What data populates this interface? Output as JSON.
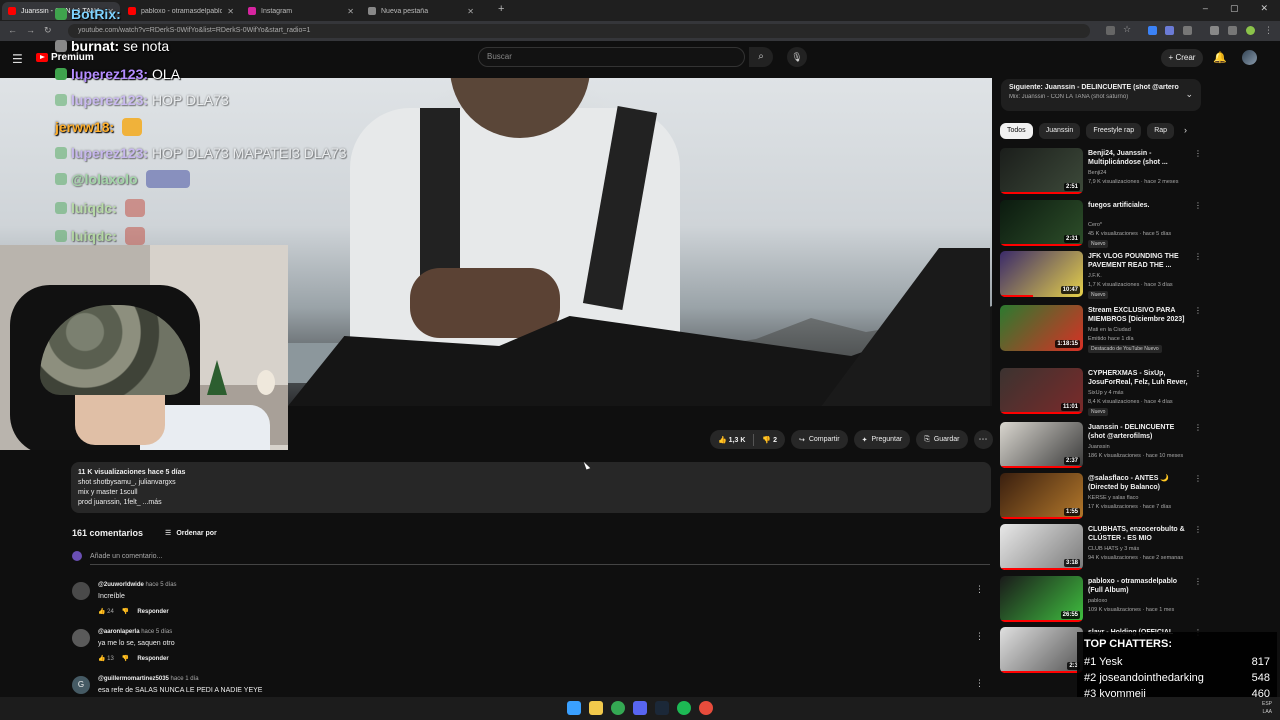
{
  "browser": {
    "tabs": [
      {
        "label": "Juanssin - CON LA TANA (s",
        "icon_color": "#ff0000",
        "active": true
      },
      {
        "label": "pabloxo - otramasdelpablo (Fu",
        "icon_color": "#ff0000",
        "active": false
      },
      {
        "label": "Instagram",
        "icon_color": "#d6249f",
        "active": false
      },
      {
        "label": "Nueva pestaña",
        "icon_color": "#888888",
        "active": false
      }
    ],
    "url": "youtube.com/watch?v=RDerkS-0WifYo&list=RDerkS-0WifYo&start_radio=1"
  },
  "youtube": {
    "logo_text": "Premium",
    "search_placeholder": "Buscar",
    "create_label": "Crear"
  },
  "video_actions": {
    "likes": "1,3 K",
    "dislikes": "2",
    "share": "Compartir",
    "ask": "Preguntar",
    "save": "Guardar"
  },
  "description": {
    "line1": "11 K visualizaciones  hace 5 días",
    "line2": "shot shotbysamu_, julianvargxs",
    "line3": "mix y master 1scull",
    "line4": "prod juanssin, 1felt_ ...más"
  },
  "comments": {
    "count_label": "161 comentarios",
    "sort_label": "Ordenar por",
    "add_placeholder": "Añade un comentario...",
    "items": [
      {
        "author": "@2uuworldwide",
        "time": "hace 5 días",
        "text": "Increíble",
        "likes": "24",
        "reply": "Responder",
        "avatar": "#4a4a4a"
      },
      {
        "author": "@aaronlaperla",
        "time": "hace 5 días",
        "text": "ya me lo se, saquen otro",
        "likes": "13",
        "reply": "Responder",
        "avatar": "#5a5a5a"
      },
      {
        "author": "@guillermomartinez5035",
        "time": "hace 1 día",
        "text": "esa refe de SALAS NUNCA LE PEDI A NADIE YEYE",
        "avatar_letter": "G",
        "avatar": "#455a64"
      }
    ]
  },
  "sidebar": {
    "up_next_title": "Siguiente: Juanssin - DELINCUENTE (shot @artero...",
    "up_next_sub": "Mix: Juanssin - CON LA TANA (shot saturno)",
    "chips": [
      "Todos",
      "Juanssin",
      "Freestyle rap",
      "Rap"
    ],
    "recommendations": [
      {
        "title": "Benji24, Juanssin - Multiplicándose (shot ...",
        "channel": "Benji24",
        "views": "7,9 K visualizaciones · hace 2 meses",
        "duration": "2:51",
        "colors": [
          "#1b1e1b",
          "#3d4a3a"
        ],
        "progress": 1
      },
      {
        "title": "fuegos artificiales.",
        "channel": "Cero*",
        "views": "45 K visualizaciones · hace 5 días",
        "tag": "Nuevo",
        "duration": "2:31",
        "colors": [
          "#0b1a0f",
          "#2e4f2a"
        ],
        "progress": 1
      },
      {
        "title": "JFK VLOG POUNDING THE PAVEMENT READ THE ...",
        "channel": "J.F.K.",
        "views": "1,7 K visualizaciones · hace 3 días",
        "tag": "Nuevo",
        "duration": "10:47",
        "colors": [
          "#3a2a6a",
          "#e6d14a"
        ],
        "progress": 0.4
      },
      {
        "title": "Stream EXCLUSIVO PARA MIEMBROS [Diciembre 2023]",
        "channel": "Mati en la Ciudad",
        "views": "Emitido hace 1 día",
        "tag": "Destacado de YouTube  Nuevo",
        "duration": "1:18:15",
        "colors": [
          "#2b7a2f",
          "#d93025"
        ],
        "progress": 0
      },
      {
        "title": "CYPHERXMAS - SixUp, JosuForReal, Felz, Luh Rever, ...",
        "channel": "SixUp y 4 más",
        "views": "8,4 K visualizaciones · hace 4 días",
        "tag": "Nuevo",
        "duration": "11:01",
        "colors": [
          "#3b3330",
          "#7b2a2a"
        ],
        "progress": 1
      },
      {
        "title": "Juanssin - DELINCUENTE (shot @arterofilms)",
        "channel": "Juanssin",
        "views": "186 K visualizaciones · hace 10 meses",
        "duration": "2:37",
        "colors": [
          "#d9d6cf",
          "#3a3a3a"
        ],
        "progress": 1
      },
      {
        "title": "@salasflaco - ANTES 🌙 (Directed by Balanco)",
        "channel": "KERSE y salas flaco",
        "views": "17 K visualizaciones · hace 7 días",
        "duration": "1:55",
        "colors": [
          "#3a1f0f",
          "#b3782b"
        ],
        "progress": 1
      },
      {
        "title": "CLUBHATS, enzocerobulto & CLÚSTER - ES MIO",
        "channel": "CLUB HATS y 3 más",
        "views": "94 K visualizaciones · hace 2 semanas",
        "duration": "3:18",
        "colors": [
          "#e8e8e8",
          "#7a7a7a"
        ],
        "progress": 1
      },
      {
        "title": "pabloxo - otramasdelpablo (Full Album)",
        "channel": "pabloxo",
        "views": "109 K visualizaciones · hace 1 mes",
        "duration": "26:55",
        "colors": [
          "#1a1a1a",
          "#3fbf3f"
        ],
        "progress": 1
      },
      {
        "title": "slayr - Holding (OFFICIAL",
        "channel": "",
        "views": "",
        "duration": "2:3",
        "colors": [
          "#e0e0e0",
          "#555555"
        ],
        "progress": 1
      }
    ]
  },
  "stream_overlay": {
    "chat": [
      {
        "user": "BotRix:",
        "msg": "",
        "color": "#7fd3ff",
        "faded": false,
        "badge": "#3fa34d"
      },
      {
        "user": "burnat:",
        "msg": "se nota",
        "color": "#ffffff",
        "faded": false,
        "badge": "#888888"
      },
      {
        "user": "luperez123:",
        "msg": "OLA",
        "color": "#b48cff",
        "faded": false,
        "badge": "#3fa34d"
      },
      {
        "user": "luperez123:",
        "msg": "HOP DLA73",
        "color": "#b48cff",
        "faded": true,
        "badge": "#3fa34d"
      },
      {
        "user": "jerww18:",
        "msg": "",
        "color": "#ffb02e",
        "faded": false,
        "badge": ""
      },
      {
        "user": "luperez123:",
        "msg": "HOP DLA73 MAPATEI3 DLA73",
        "color": "#b48cff",
        "faded": true,
        "badge": "#3fa34d"
      },
      {
        "user": "@lolaxolo",
        "msg": "",
        "color": "#6cd36c",
        "faded": true,
        "badge": "#3fa34d"
      },
      {
        "user": "luiqdc:",
        "msg": "",
        "color": "#9be26c",
        "faded": true,
        "badge": "#3fa34d"
      },
      {
        "user": "luiqdc:",
        "msg": "",
        "color": "#9be26c",
        "faded": true,
        "badge": "#3fa34d"
      }
    ],
    "top_chatters_title": "TOP CHATTERS:",
    "top_chatters": [
      {
        "rank": "#1",
        "name": "Yesk",
        "count": "817"
      },
      {
        "rank": "#2",
        "name": "joseandointhedarking",
        "count": "548"
      },
      {
        "rank": "#3",
        "name": "kyommeii",
        "count": "460"
      }
    ]
  },
  "taskbar": {
    "tray_line1": "ESP",
    "tray_line2": "LAA"
  }
}
